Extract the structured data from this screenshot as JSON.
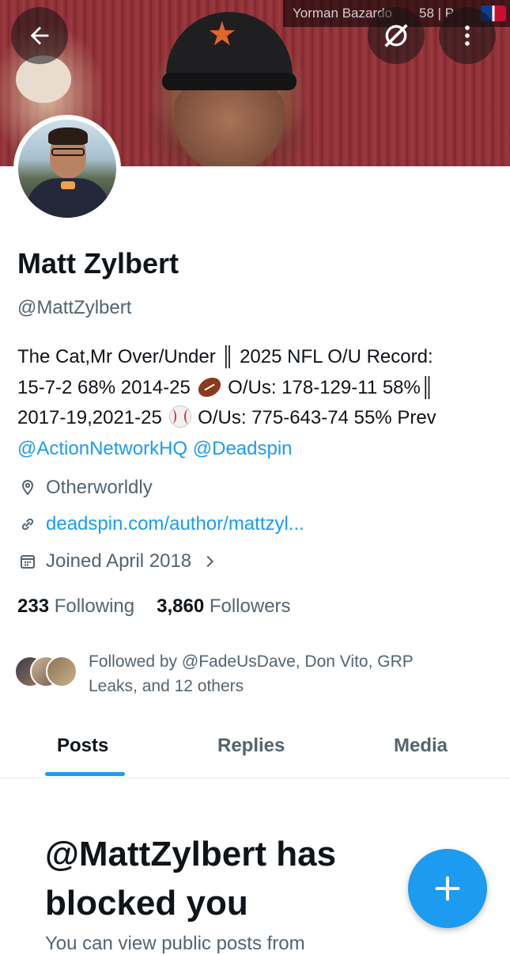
{
  "banner": {
    "watermark_name": "Yorman Bazardo",
    "watermark_number": "58 | P"
  },
  "profile": {
    "name": "Matt Zylbert",
    "handle": "@MattZylbert",
    "bio": {
      "line1": "The Cat,Mr Over/Under ║ 2025 NFL O/U Record:",
      "line2_a": "15-7-2 68% 2014-25",
      "line2_b": "O/Us: 178-129-11 58%║",
      "line3_a": "2017-19,2021-25",
      "line3_b": "O/Us: 775-643-74 55% Prev",
      "mention1": "@ActionNetworkHQ",
      "mention2": "@Deadspin"
    },
    "location": "Otherworldly",
    "website": "deadspin.com/author/mattzyl...",
    "joined": "Joined April 2018",
    "following_count": "233",
    "following_label": "Following",
    "followers_count": "3,860",
    "followers_label": "Followers",
    "followed_by": "Followed by @FadeUsDave, Don Vito, GRP Leaks, and 12 others"
  },
  "tabs": [
    {
      "label": "Posts"
    },
    {
      "label": "Replies"
    },
    {
      "label": "Media"
    }
  ],
  "blocked": {
    "title": "@MattZylbert has blocked you",
    "subtitle": "You can view public posts from"
  },
  "icons": {
    "back": "arrow-left-icon",
    "grok": "grok-icon",
    "more": "more-vertical-icon",
    "location": "location-pin-icon",
    "link": "link-icon",
    "calendar": "calendar-icon",
    "chevron": "chevron-right-icon",
    "compose": "plus-icon"
  },
  "colors": {
    "accent": "#1d9bf0",
    "text": "#0f1419",
    "muted": "#536471"
  }
}
